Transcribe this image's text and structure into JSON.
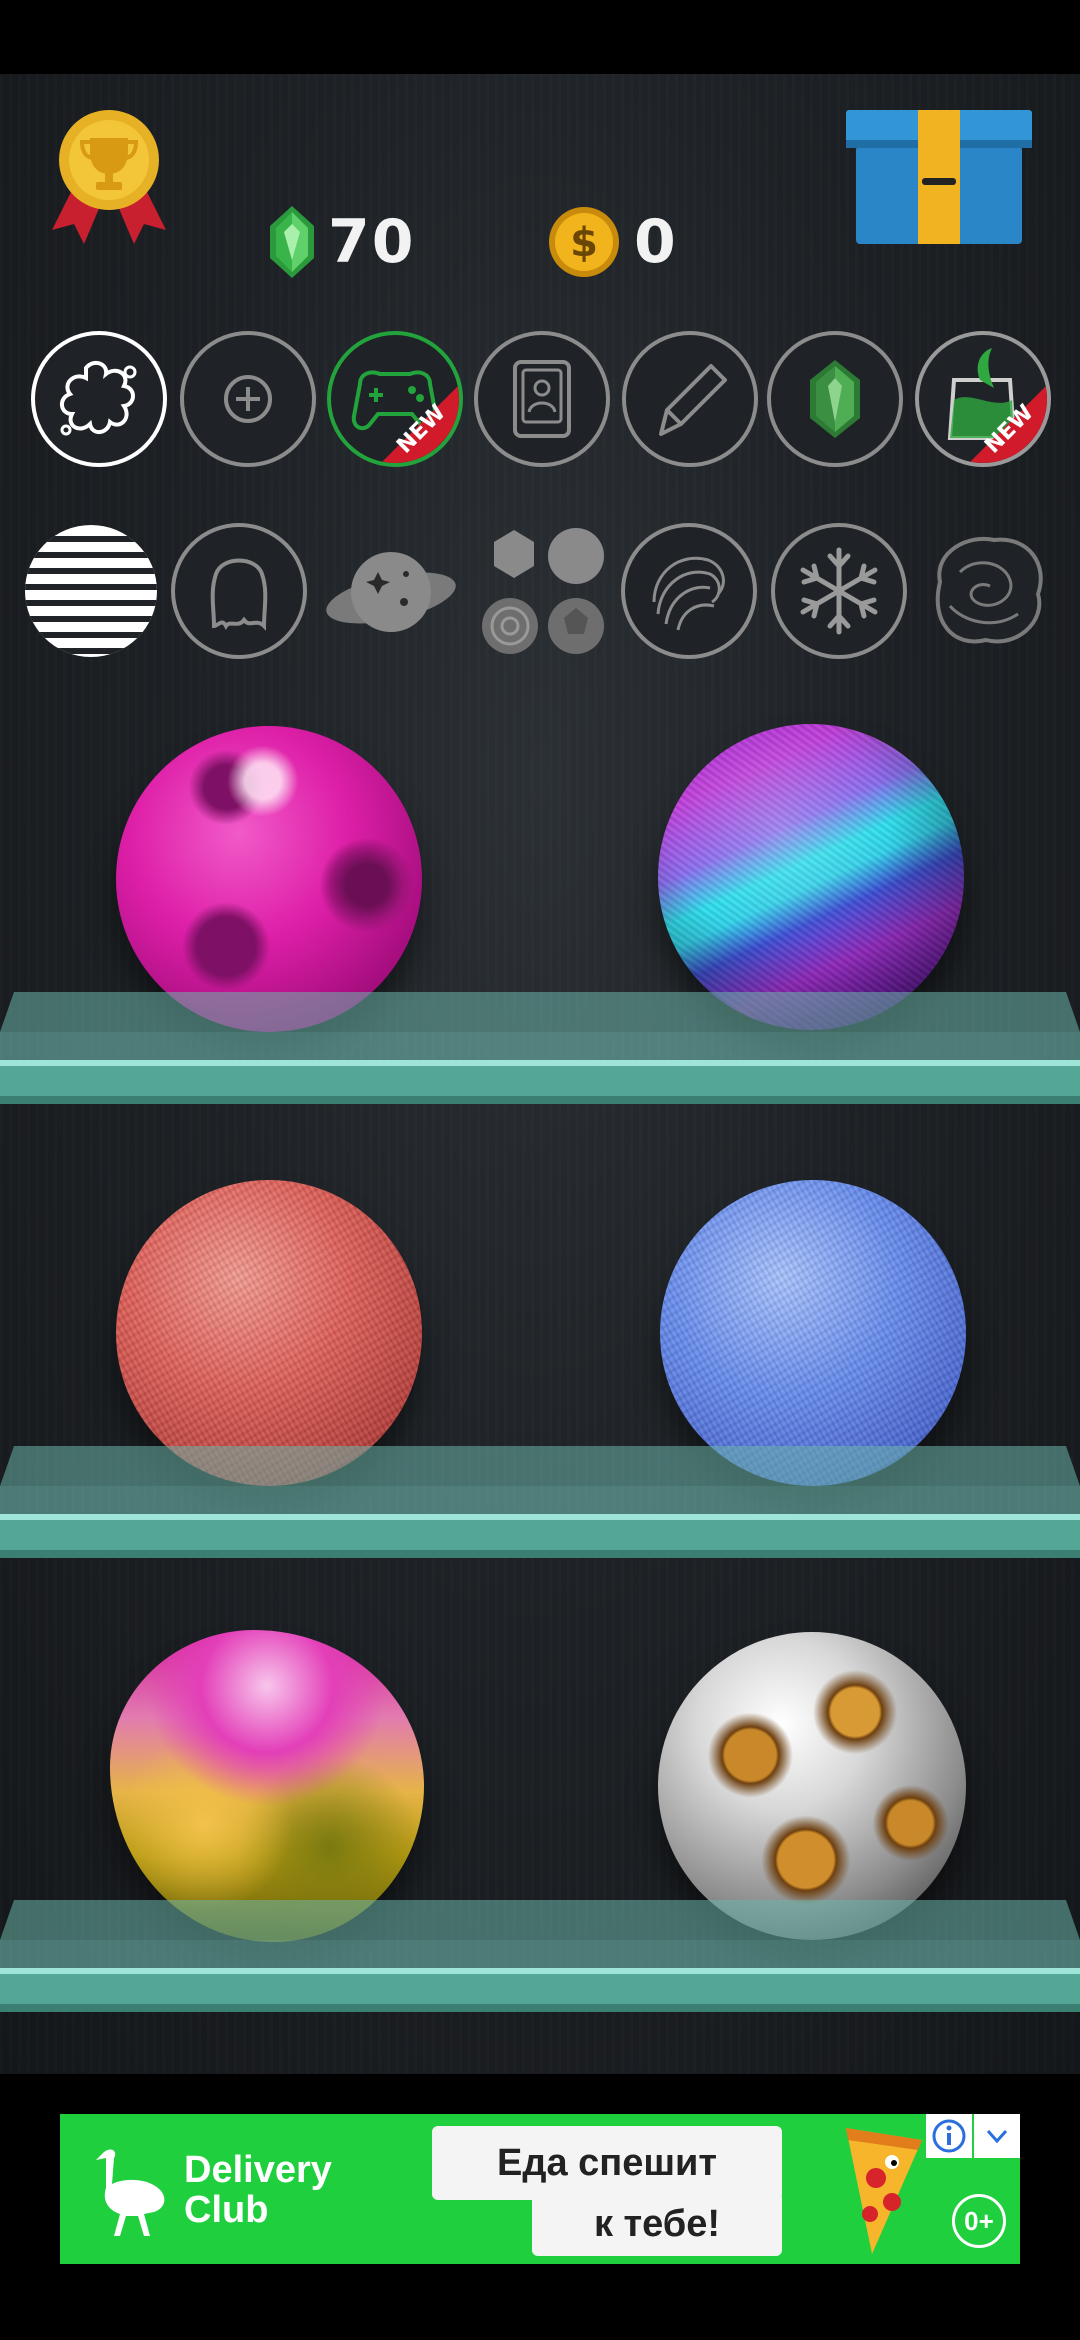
{
  "currency": {
    "gems": "70",
    "coins": "0",
    "coin_symbol": "$"
  },
  "categories_row1": [
    {
      "name": "splat-icon",
      "selected": true
    },
    {
      "name": "plus-icon",
      "selected": false
    },
    {
      "name": "gamepad-icon",
      "badge": "NEW"
    },
    {
      "name": "profile-card-icon"
    },
    {
      "name": "pencil-icon"
    },
    {
      "name": "gem-icon"
    },
    {
      "name": "slime-jar-icon",
      "badge": "NEW"
    }
  ],
  "categories_row2": [
    {
      "name": "stripes-icon"
    },
    {
      "name": "ghost-icon"
    },
    {
      "name": "planet-icon"
    },
    {
      "name": "textures-icon"
    },
    {
      "name": "swirl-icon"
    },
    {
      "name": "snowflake-icon"
    },
    {
      "name": "marble-icon"
    }
  ],
  "balls": [
    {
      "name": "pink-crater-ball"
    },
    {
      "name": "purple-cyan-stripe-ball"
    },
    {
      "name": "coral-textured-ball"
    },
    {
      "name": "blue-textured-ball"
    },
    {
      "name": "pink-gold-blob-ball"
    },
    {
      "name": "silver-gold-marble-ball"
    }
  ],
  "ad": {
    "brand_line1": "Delivery",
    "brand_line2": "Club",
    "bubble_line1": "Еда спешит",
    "bubble_line2": "к тебе!",
    "age_rating": "0+"
  },
  "colors": {
    "shelf": "#5aa89c",
    "ad_bg": "#1fcf3e",
    "new_badge": "#d11a2a",
    "selected_ring": "#ffffff",
    "unselected_ring": "#9a9a9a"
  }
}
